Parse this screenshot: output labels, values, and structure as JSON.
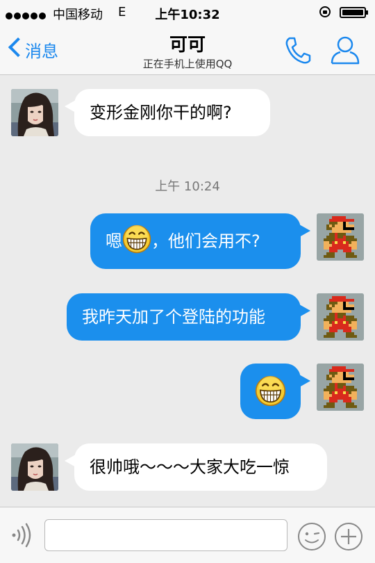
{
  "status_bar": {
    "carrier": "中国移动",
    "network": "E",
    "time": "上午10:32"
  },
  "nav": {
    "back_label": "消息",
    "title": "可可",
    "subtitle": "正在手机上使用QQ",
    "icons": [
      "phone-icon",
      "profile-icon"
    ]
  },
  "messages": [
    {
      "side": "in",
      "text": "变形金刚你干的啊?"
    },
    {
      "side": "out",
      "text_before": "嗯",
      "text_after": "，他们会用不?",
      "emoji": "grin-emoji"
    },
    {
      "side": "out",
      "text": "我昨天加了个登陆的功能"
    },
    {
      "side": "out",
      "emoji": "grin-emoji"
    },
    {
      "side": "in",
      "text": "很帅哦～～～大家大吃一惊"
    }
  ],
  "timestamp": "上午 10:24",
  "input_bar": {
    "placeholder": "",
    "icons": [
      "voice-icon",
      "emoji-face-icon",
      "plus-icon"
    ]
  },
  "colors": {
    "accent": "#1b88ee",
    "bubble_out": "#1b8fed",
    "bubble_in": "#ffffff",
    "background": "#ebebeb"
  }
}
